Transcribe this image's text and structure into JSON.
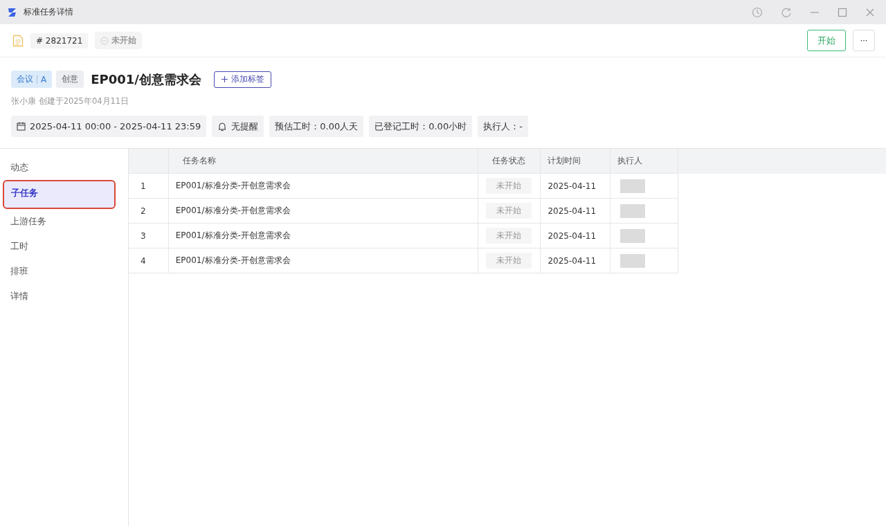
{
  "window": {
    "title": "标准任务详情"
  },
  "toolbar": {
    "task_id": "# 2821721",
    "status": "未开始",
    "start_button": "开始",
    "more_button": "···"
  },
  "header": {
    "tags": [
      {
        "label": "会议",
        "extra": "A"
      },
      {
        "label": "创意"
      }
    ],
    "title": "EP001/创意需求会",
    "add_tag": "添加标签",
    "creator": "张小康 创建于2025年04月11日",
    "info": [
      {
        "kind": "date",
        "text": "2025-04-11 00:00 - 2025-04-11 23:59"
      },
      {
        "kind": "reminder",
        "text": "无提醒"
      },
      {
        "kind": "plain",
        "text": "预估工时：0.00人天"
      },
      {
        "kind": "plain",
        "text": "已登记工时：0.00小时"
      },
      {
        "kind": "plain",
        "text": "执行人：-"
      }
    ]
  },
  "sidebar": {
    "items": [
      {
        "label": "动态",
        "selected": false
      },
      {
        "label": "子任务",
        "selected": true
      },
      {
        "label": "上游任务",
        "selected": false
      },
      {
        "label": "工时",
        "selected": false
      },
      {
        "label": "排班",
        "selected": false
      },
      {
        "label": "详情",
        "selected": false
      }
    ]
  },
  "table": {
    "columns": [
      "任务名称",
      "任务状态",
      "计划时间",
      "执行人"
    ],
    "rows": [
      {
        "index": "1",
        "name": "EP001/标准分类-开创意需求会",
        "status": "未开始",
        "date": "2025-04-11"
      },
      {
        "index": "2",
        "name": "EP001/标准分类-开创意需求会",
        "status": "未开始",
        "date": "2025-04-11"
      },
      {
        "index": "3",
        "name": "EP001/标准分类-开创意需求会",
        "status": "未开始",
        "date": "2025-04-11"
      },
      {
        "index": "4",
        "name": "EP001/标准分类-开创意需求会",
        "status": "未开始",
        "date": "2025-04-11"
      }
    ]
  }
}
